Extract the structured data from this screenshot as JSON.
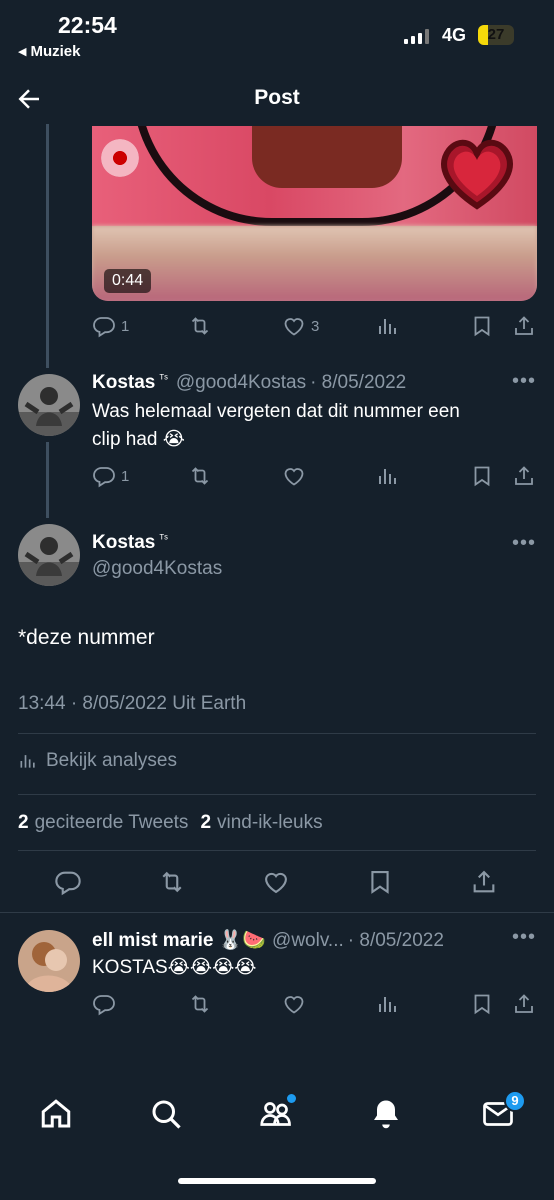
{
  "status_bar": {
    "time": "22:54",
    "back_app": "Muziek",
    "network": "4G",
    "battery": "27"
  },
  "header": {
    "title": "Post"
  },
  "media": {
    "duration": "0:44"
  },
  "tweet1_actions": {
    "replies": "1",
    "likes": "3"
  },
  "reply1": {
    "name": "Kostas",
    "badge": "ᵀˢ",
    "handle": "@good4Kostas",
    "date": "· 8/05/2022",
    "text_line1": "Was helemaal vergeten dat dit nummer een",
    "text_line2": "clip had 😭",
    "replies": "1"
  },
  "main_post": {
    "name": "Kostas",
    "badge": "ᵀˢ",
    "handle": "@good4Kostas",
    "text": "*deze nummer",
    "timestamp": "13:44 · 8/05/2022 Uit Earth",
    "analytics": "Bekijk analyses",
    "quotes_count": "2",
    "quotes_label": "geciteerde Tweets",
    "likes_count": "2",
    "likes_label": "vind-ik-leuks"
  },
  "reply2": {
    "name": "ell mist marie 🐰🍉",
    "handle": "@wolv...",
    "date": "· 8/05/2022",
    "text": "KOSTAS😭😭😭😭"
  },
  "tabbar": {
    "messages_badge": "9"
  },
  "icons": [
    "back-arrow-icon",
    "reply-icon",
    "retweet-icon",
    "like-icon",
    "views-icon",
    "bookmark-icon",
    "share-icon",
    "more-icon",
    "home-icon",
    "search-icon",
    "communities-icon",
    "notifications-icon",
    "messages-icon"
  ]
}
